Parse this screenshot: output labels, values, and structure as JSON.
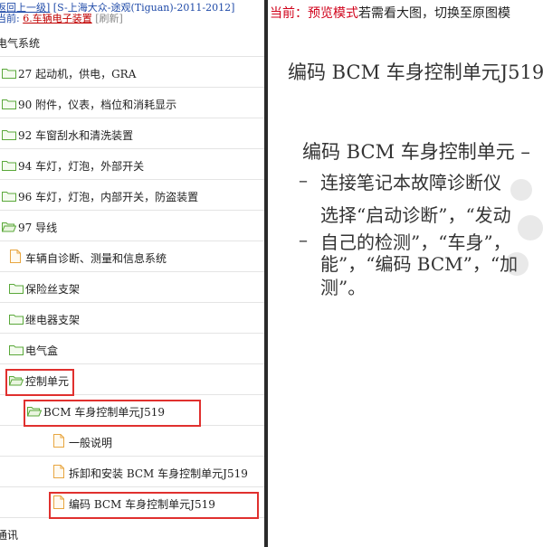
{
  "left_panel": {
    "back_link": "返回上一级]",
    "breadcrumb": "[S-上海大众-途观(Tiguan)-2011-2012]",
    "current_prefix": "当前: ",
    "current_item": "6.车辆电子装置",
    "refresh_label": "[刷新]",
    "tree": [
      {
        "label": "电气系统",
        "type": "plain",
        "indent": 0
      },
      {
        "label": "27 起动机，供电，GRA",
        "type": "folder",
        "indent": 0
      },
      {
        "label": "90 附件，仪表，档位和消耗显示",
        "type": "folder",
        "indent": 0
      },
      {
        "label": "92 车窗刮水和清洗装置",
        "type": "folder",
        "indent": 0
      },
      {
        "label": "94 车灯，灯泡，外部开关",
        "type": "folder",
        "indent": 0
      },
      {
        "label": "96 车灯，灯泡，内部开关，防盗装置",
        "type": "folder",
        "indent": 0
      },
      {
        "label": "97 导线",
        "type": "folder-open",
        "indent": 0
      },
      {
        "label": "车辆自诊断、测量和信息系统",
        "type": "doc",
        "indent": 1
      },
      {
        "label": "保险丝支架",
        "type": "folder",
        "indent": 1
      },
      {
        "label": "继电器支架",
        "type": "folder",
        "indent": 1
      },
      {
        "label": "电气盒",
        "type": "folder",
        "indent": 1
      },
      {
        "label": "控制单元",
        "type": "folder-open",
        "indent": 1,
        "highlighted": true
      },
      {
        "label": "BCM 车身控制单元J519",
        "type": "folder-open",
        "indent": 2,
        "highlighted": true
      },
      {
        "label": "一般说明",
        "type": "doc",
        "indent": 3
      },
      {
        "label": "拆卸和安装 BCM 车身控制单元J519",
        "type": "doc",
        "indent": 3
      },
      {
        "label": "编码 BCM 车身控制单元J519",
        "type": "doc",
        "indent": 3,
        "highlighted": true
      },
      {
        "label": "通讯",
        "type": "plain",
        "indent": 0
      }
    ]
  },
  "right_panel": {
    "notice_prefix": "当前：预览模式",
    "notice_suffix": "若需看大图，切换至原图模",
    "doc_title": "编码  BCM  车身控制单元J519",
    "section_title": "编码 BCM 车身控制单元 –",
    "bullet1_line1": "连接笔记本故障诊断仪",
    "bullet1_line2": "选择“启动诊断”，“发动",
    "bullet2_line1": "自己的检测”，“车身”，",
    "bullet2_line2": "能”，“编码 BCM”，“加",
    "bullet2_line3": "测”。",
    "bullet_mark": "–"
  },
  "colors": {
    "link_blue": "#1f4aa8",
    "highlight_red": "#e0302e",
    "notice_red": "#d0021b",
    "folder_green": "#5aa83a",
    "doc_orange": "#e8a640"
  },
  "icons": {
    "folder": "folder-icon",
    "folder_open": "folder-open-icon",
    "doc": "document-icon"
  }
}
